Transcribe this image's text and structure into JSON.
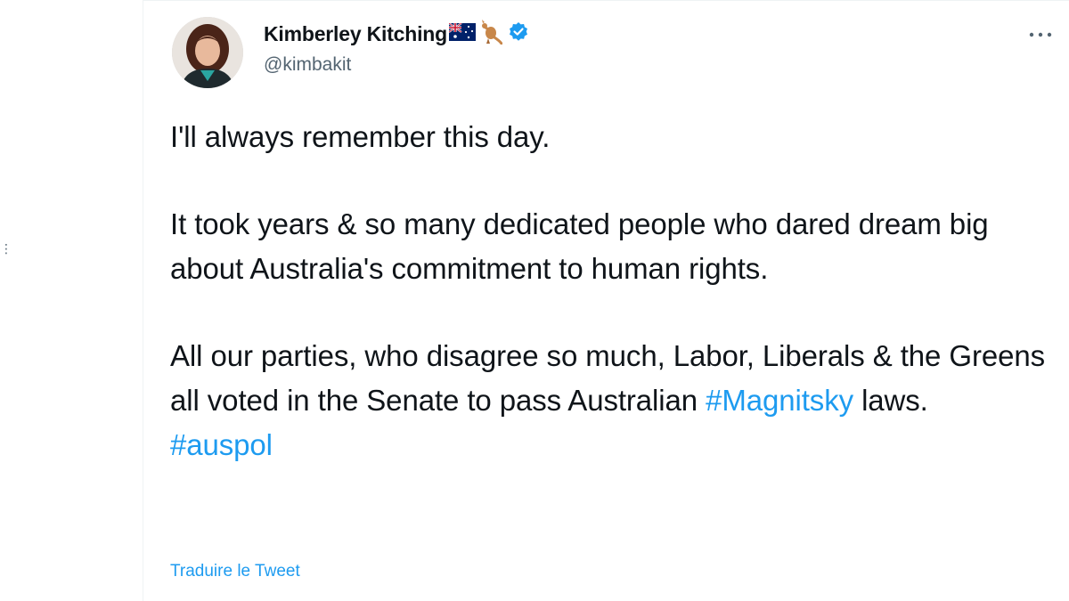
{
  "author": {
    "display_name": "Kimberley Kitching",
    "handle": "@kimbakit",
    "avatar_icon": "profile-photo",
    "name_emojis": [
      "australia-flag-emoji",
      "kangaroo-emoji"
    ],
    "verified_icon": "verified-badge-icon"
  },
  "tweet": {
    "line1": "I'll always remember this day.",
    "para2": "It took years & so many dedicated people who dared dream big about Australia's commitment to human rights.",
    "para3_before": "All our parties, who disagree so much, Labor, Liberals & the Greens all voted in the Senate to pass Australian ",
    "hashtag1": "#Magnitsky",
    "para3_after": " laws.",
    "hashtag2": "#auspol"
  },
  "translate_label": "Traduire le Tweet",
  "more_icon": "more-options-icon",
  "colors": {
    "link": "#1d9bf0",
    "text": "#0f1419",
    "secondary": "#536471",
    "verified": "#1d9bf0"
  }
}
